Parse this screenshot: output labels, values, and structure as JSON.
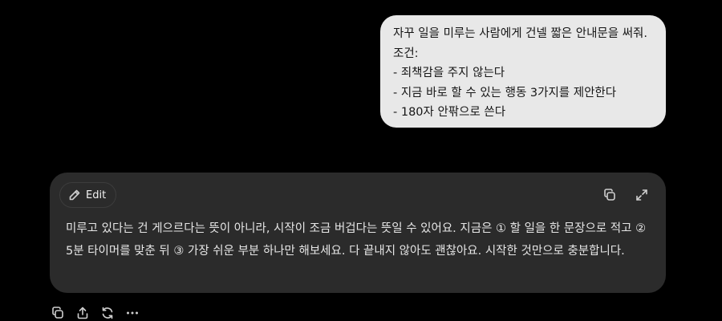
{
  "user_message": {
    "lines": [
      "자꾸 일을 미루는 사람에게 건넬 짧은 안내문을 써줘.",
      "조건:",
      "- 죄책감을 주지 않는다",
      "- 지금 바로 할 수 있는 행동 3가지를 제안한다",
      "- 180자 안팎으로 쓴다"
    ]
  },
  "assistant_message": {
    "edit_label": "Edit",
    "text": "미루고 있다는 건 게으르다는 뜻이 아니라, 시작이 조금 버겁다는 뜻일 수 있어요. 지금은 ① 할 일을 한 문장으로 적고 ② 5분 타이머를 맞춘 뒤 ③ 가장 쉬운 부분 하나만 해보세요. 다 끝내지 않아도 괜찮아요. 시작한 것만으로 충분합니다.",
    "icons": [
      "copy-icon",
      "expand-icon"
    ]
  },
  "actions": {
    "icons": [
      "copy-icon",
      "share-icon",
      "regenerate-icon",
      "more-icon"
    ]
  },
  "colors": {
    "background": "#000000",
    "user_bubble": "#e8e8e8",
    "assistant_card": "#2b2b2b",
    "text_light": "#e6e6e6",
    "text_dark": "#161616"
  }
}
